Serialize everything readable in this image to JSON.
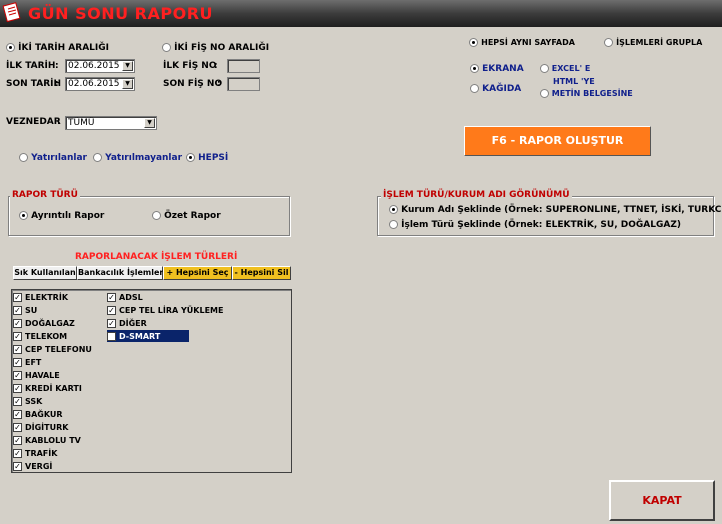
{
  "window": {
    "title": "GÜN SONU RAPORU"
  },
  "range": {
    "date_range_label": "İKİ TARİH ARALIĞI",
    "fis_range_label": "İKİ FİŞ NO ARALIĞI",
    "first_date_label": "İLK TARİH",
    "last_date_label": "SON TARİH",
    "first_date_value": "02.06.2015",
    "last_date_value": "02.06.2015",
    "first_fis_label": "İLK FİŞ NO",
    "last_fis_label": "SON FİŞ NO",
    "first_fis_value": "",
    "last_fis_value": "",
    "colon": ":"
  },
  "page_options": {
    "same_page": "HEPSİ AYNI SAYFADA",
    "group_ops": "İŞLEMLERİ GRUPLA"
  },
  "output": {
    "screen": "EKRANA",
    "paper": "KAĞIDA",
    "excel": "EXCEL' E",
    "html": "HTML 'YE",
    "text_doc": "METİN BELGESİNE"
  },
  "teller": {
    "label": "VEZNEDAR",
    "value": "TÜMÜ"
  },
  "filter": {
    "paid": "Yatırılanlar",
    "unpaid": "Yatırılmayanlar",
    "all": "HEPSİ"
  },
  "create_button": "F6 - RAPOR OLUŞTUR",
  "report_type": {
    "title": "RAPOR TÜRÜ",
    "detailed": "Ayrıntılı Rapor",
    "summary": "Özet Rapor"
  },
  "view": {
    "title": "İŞLEM TÜRÜ/KURUM ADI GÖRÜNÜMÜ",
    "by_company": "Kurum Adı Şeklinde  (Örnek: SUPERONLINE, TTNET, İSKİ, TURKCELL)",
    "by_type": "İşlem Türü Şeklinde  (Örnek: ELEKTRİK, SU, DOĞALGAZ)"
  },
  "ops": {
    "title": "RAPORLANACAK İŞLEM TÜRLERİ",
    "btn_frequent": "Sık Kullanılan",
    "btn_banking": "Bankacılık İşlemleri",
    "btn_select_all": "+ Hepsini Seç",
    "btn_clear_all": "- Hepsini Sil",
    "col1": [
      "ELEKTRİK",
      "SU",
      "DOĞALGAZ",
      "TELEKOM",
      "CEP TELEFONU",
      "EFT",
      "HAVALE",
      "KREDİ KARTI",
      "SSK",
      "BAĞKUR",
      "DİGİTURK",
      "KABLOLU TV",
      "TRAFİK",
      "VERGİ"
    ],
    "col2": [
      "ADSL",
      "CEP TEL LİRA YÜKLEME",
      "DİĞER",
      "D-SMART"
    ],
    "check_mark": "✓"
  },
  "close_button": "KAPAT",
  "colors": {
    "accent": "#ff7a1a",
    "title_red": "#ff2020",
    "selected": "#0a246a"
  }
}
